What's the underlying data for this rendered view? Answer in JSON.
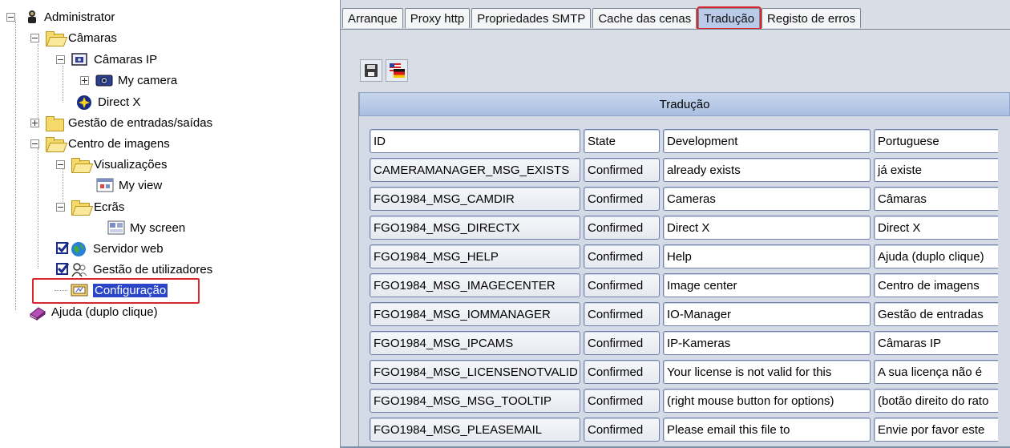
{
  "tree": {
    "root": "Administrator",
    "cameras": "Câmaras",
    "ip_cameras": "Câmaras IP",
    "my_camera": "My camera",
    "directx": "Direct X",
    "io_management": "Gestão de entradas/saídas",
    "image_center": "Centro de imagens",
    "views": "Visualizações",
    "my_view": "My view",
    "screens": "Ecrãs",
    "my_screen": "My screen",
    "web_server": "Servidor web",
    "user_management": "Gestão de utilizadores",
    "configuration": "Configuração",
    "help": "Ajuda (duplo clique)"
  },
  "tabs": [
    {
      "label": "Arranque"
    },
    {
      "label": "Proxy http"
    },
    {
      "label": "Propriedades SMTP"
    },
    {
      "label": "Cache das cenas"
    },
    {
      "label": "Tradução",
      "active": true
    },
    {
      "label": "Registo de erros"
    }
  ],
  "toolbar": {
    "save_icon": "save-icon",
    "language_icon": "language-flag-icon"
  },
  "panel": {
    "title": "Tradução"
  },
  "table": {
    "headers": [
      "ID",
      "State",
      "Development",
      "Portuguese"
    ],
    "rows": [
      [
        "CAMERAMANAGER_MSG_EXISTS",
        "Confirmed",
        "already exists",
        "já existe"
      ],
      [
        "FGO1984_MSG_CAMDIR",
        "Confirmed",
        "Cameras",
        "Câmaras"
      ],
      [
        "FGO1984_MSG_DIRECTX",
        "Confirmed",
        "Direct X",
        "Direct X"
      ],
      [
        "FGO1984_MSG_HELP",
        "Confirmed",
        "Help",
        "Ajuda (duplo clique)"
      ],
      [
        "FGO1984_MSG_IMAGECENTER",
        "Confirmed",
        "Image center",
        "Centro de imagens"
      ],
      [
        "FGO1984_MSG_IOMMANAGER",
        "Confirmed",
        "IO-Manager",
        "Gestão de entradas"
      ],
      [
        "FGO1984_MSG_IPCAMS",
        "Confirmed",
        "IP-Kameras",
        "Câmaras IP"
      ],
      [
        "FGO1984_MSG_LICENSENOTVALID",
        "Confirmed",
        "Your license is not valid for this",
        "A sua licença não é"
      ],
      [
        "FGO1984_MSG_MSG_TOOLTIP",
        "Confirmed",
        "(right mouse button for options)",
        "(botão direito do rato"
      ],
      [
        "FGO1984_MSG_PLEASEMAIL",
        "Confirmed",
        "Please email this file to",
        "Envie por favor este"
      ]
    ]
  },
  "colors": {
    "highlight": "#d8272d",
    "selection": "#2a45c8",
    "panel_bg": "#d5dbe6"
  }
}
